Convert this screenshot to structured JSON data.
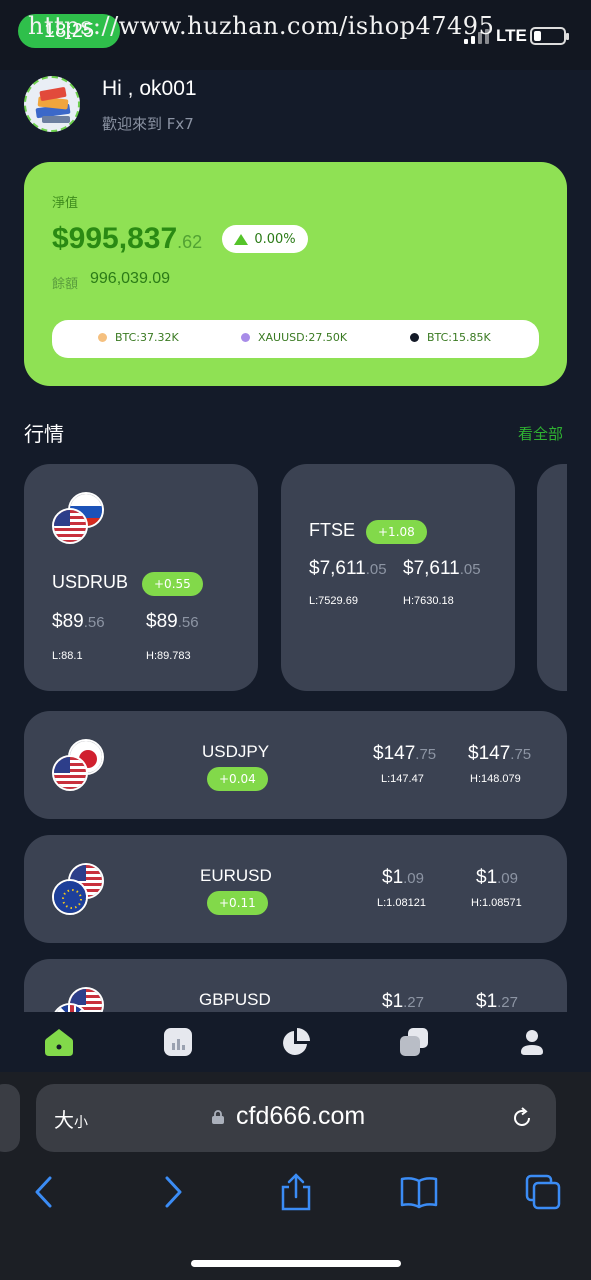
{
  "status": {
    "time": "18:25",
    "watermark": "https://www.huzhan.com/ishop47495",
    "network": "LTE"
  },
  "header": {
    "greeting": "Hi , ok001",
    "welcome": "歡迎來到 Fx7"
  },
  "account": {
    "equity_label": "淨值",
    "equity_main": "$995,837",
    "equity_decimal": ".62",
    "change": "0.00%",
    "balance_label": "餘額",
    "balance": "996,039.09",
    "positions": [
      {
        "label": "BTC:37.32K",
        "color": "#f5c07f"
      },
      {
        "label": "XAUUSD:27.50K",
        "color": "#a88ce8"
      },
      {
        "label": "BTC:15.85K",
        "color": "#141a28"
      }
    ]
  },
  "market": {
    "title": "行情",
    "see_all": "看全部",
    "cards": [
      {
        "symbol": "USDRUB",
        "change": "+0.55",
        "bid_main": "$89",
        "bid_dec": ".56",
        "ask_main": "$89",
        "ask_dec": ".56",
        "low": "L:88.1",
        "high": "H:89.783"
      },
      {
        "symbol": "FTSE",
        "change": "+1.08",
        "bid_main": "$7,611",
        "bid_dec": ".05",
        "ask_main": "$7,611",
        "ask_dec": ".05",
        "low": "L:7529.69",
        "high": "H:7630.18"
      }
    ],
    "rows": [
      {
        "symbol": "USDJPY",
        "change": "+0.04",
        "bid_main": "$147",
        "bid_dec": ".75",
        "ask_main": "$147",
        "ask_dec": ".75",
        "low": "L:147.47",
        "high": "H:148.079"
      },
      {
        "symbol": "EURUSD",
        "change": "+0.11",
        "bid_main": "$1",
        "bid_dec": ".09",
        "ask_main": "$1",
        "ask_dec": ".09",
        "low": "L:1.08121",
        "high": "H:1.08571"
      },
      {
        "symbol": "GBPUSD",
        "change": "",
        "bid_main": "$1",
        "bid_dec": ".27",
        "ask_main": "$1",
        "ask_dec": ".27",
        "low": "",
        "high": ""
      }
    ]
  },
  "tabbar": {
    "icons": [
      "home-icon",
      "chart-icon",
      "pie-chart-icon",
      "wallet-icon",
      "user-icon"
    ],
    "active_color": "#82d94a"
  },
  "browser": {
    "aa_big": "大",
    "aa_small": "小",
    "url": "cfd666.com"
  }
}
